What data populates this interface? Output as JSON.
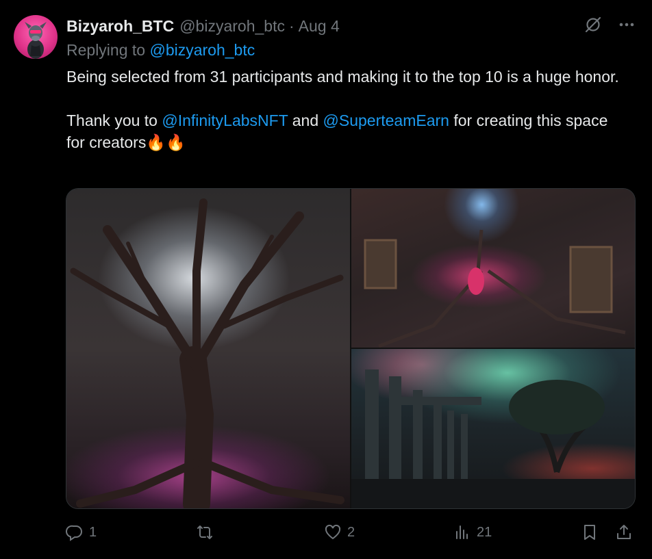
{
  "tweet": {
    "author_name": "Bizyaroh_BTC",
    "author_handle": "@bizyaroh_btc",
    "separator": "·",
    "date": "Aug 4",
    "replying_prefix": "Replying to ",
    "replying_to": "@bizyaroh_btc",
    "text_line1": "Being selected from 31 participants and making it to the top 10 is a huge honor.",
    "text_line2_prefix": "Thank you to ",
    "mention1": "@InfinityLabsNFT",
    "text_line2_mid": " and ",
    "mention2": "@SuperteamEarn",
    "text_line2_suffix": " for creating this space for creators",
    "emoji": "🔥🔥"
  },
  "top_icons": {
    "icon1": "grok-slash-icon",
    "icon2": "more-icon"
  },
  "actions": {
    "reply_count": "1",
    "repost_count": "",
    "like_count": "2",
    "views_count": "21"
  },
  "colors": {
    "background": "#000000",
    "text": "#e7e9ea",
    "muted": "#71767b",
    "link": "#1d9bf0",
    "avatar": "#e0338a"
  }
}
